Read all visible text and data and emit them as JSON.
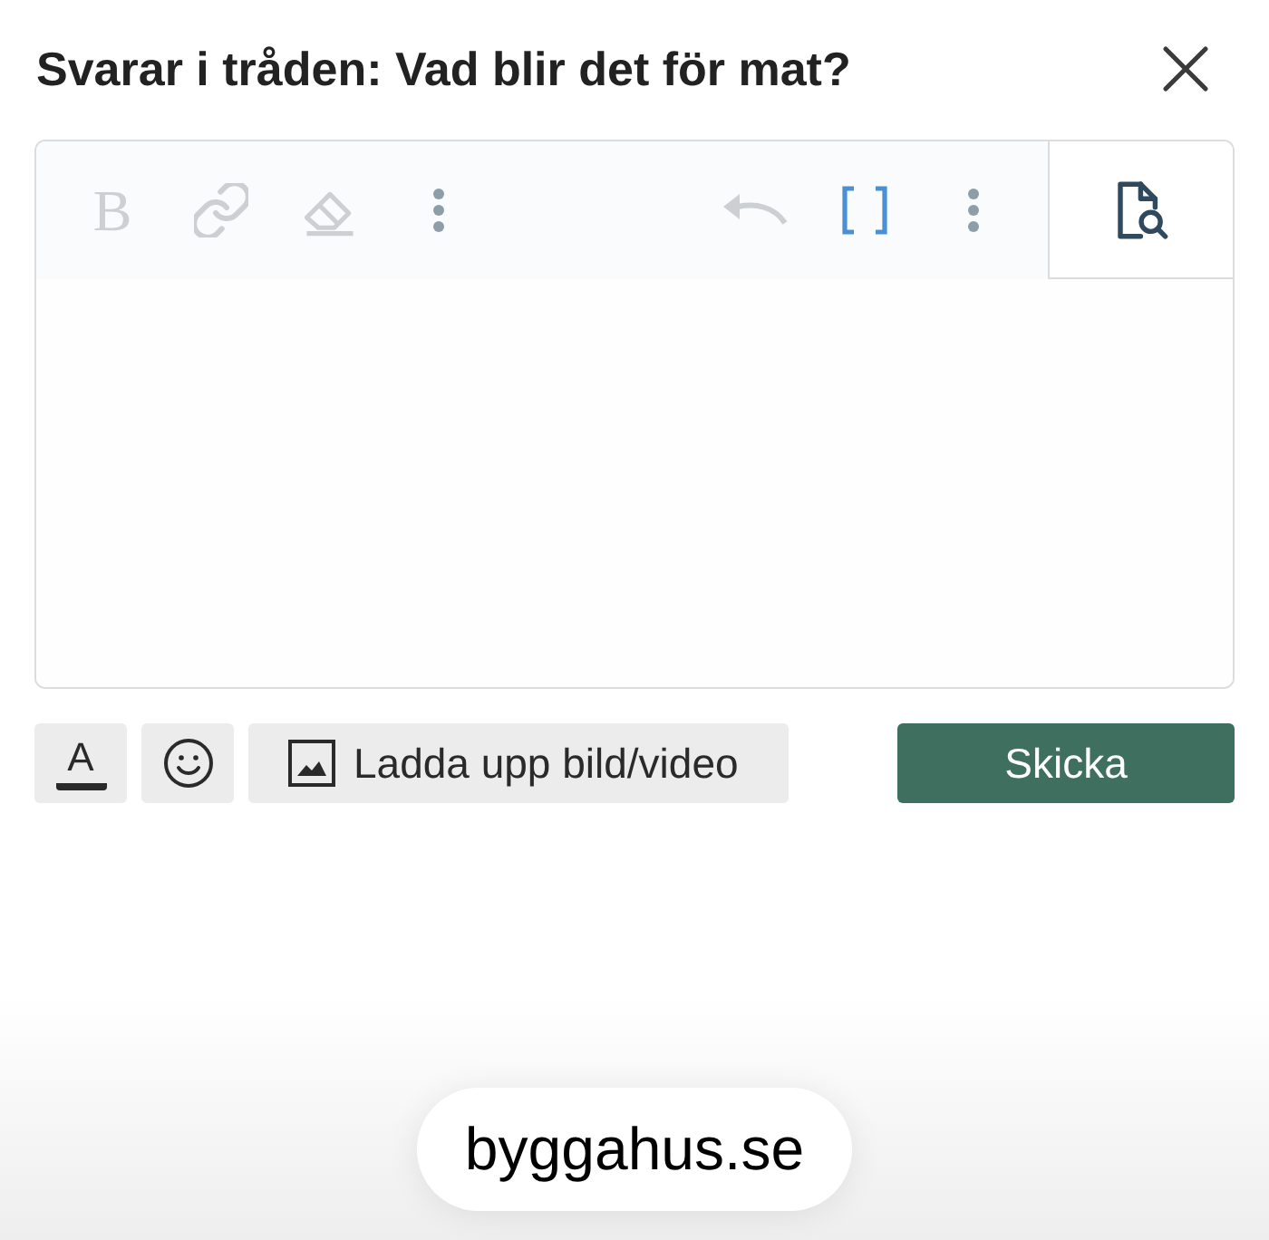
{
  "dialog": {
    "title": "Svarar i tråden: Vad blir det för mat?"
  },
  "editor": {
    "toolbar_left": [
      {
        "kind": "bold",
        "label": "B",
        "disabled": true,
        "active": false
      },
      {
        "kind": "link",
        "disabled": true,
        "active": false
      },
      {
        "kind": "eraser",
        "disabled": true,
        "active": false
      },
      {
        "kind": "more",
        "disabled": false,
        "active": false
      }
    ],
    "toolbar_right": [
      {
        "kind": "undo",
        "disabled": true,
        "active": false
      },
      {
        "kind": "bbcode",
        "disabled": false,
        "active": true
      },
      {
        "kind": "more",
        "disabled": false,
        "active": false
      }
    ],
    "preview": {
      "disabled": false
    }
  },
  "actions": [
    {
      "kind": "text_color",
      "label": "A"
    },
    {
      "kind": "emoji"
    },
    {
      "kind": "upload",
      "label": "Ladda upp bild/video"
    },
    {
      "kind": "submit",
      "label": "Skicka"
    }
  ],
  "address_bar": {
    "url": "byggahus.se"
  }
}
